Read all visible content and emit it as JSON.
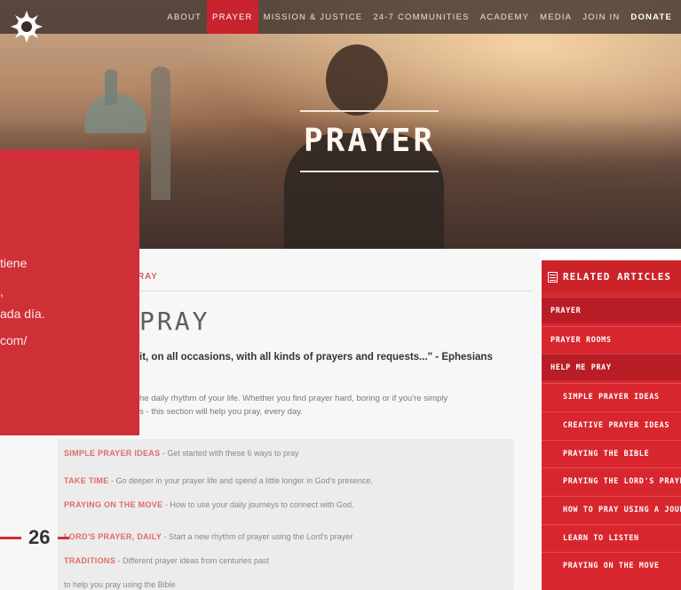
{
  "nav": {
    "items": [
      "ABOUT",
      "PRAYER",
      "MISSION & JUSTICE",
      "24-7 COMMUNITIES",
      "ACADEMY",
      "MEDIA",
      "JOIN IN",
      "DONATE"
    ],
    "active": "PRAYER"
  },
  "hero": {
    "title": "PRAYER"
  },
  "breadcrumb": "RAY",
  "page_title": "PRAY",
  "verse": {
    "line1": "it, on all occasions, with all kinds of prayers and requests...\" - Ephesians",
    "line2": ""
  },
  "intro": {
    "line1": "he daily rhythm of your life. Whether you find prayer hard, boring or if you're simply",
    "line2": "s - this section will help you pray, every day."
  },
  "list": [
    {
      "highlight": "SIMPLE PRAYER IDEAS",
      "text": " - Get started with these 6 ways to pray"
    },
    {
      "highlight": "TAKE TIME",
      "text": " - Go deeper in your prayer life and spend a little longer in God's presence."
    },
    {
      "highlight": "PRAYING ON THE MOVE",
      "text": " - How to use your daily journeys to connect with God."
    },
    {
      "highlight": "LORD'S PRAYER, DAILY",
      "text": " - Start a new rhythm of prayer using the Lord's prayer"
    },
    {
      "highlight": "TRADITIONS",
      "text": " - Different prayer ideas from centuries past"
    },
    {
      "highlight": "",
      "text": "to help you pray using the Bible"
    }
  ],
  "sidebar": {
    "header": "RELATED ARTICLES",
    "items": [
      {
        "label": "PRAYER",
        "dark": true
      },
      {
        "label": "PRAYER ROOMS",
        "dark": false
      },
      {
        "label": "HELP ME PRAY",
        "dark": true
      },
      {
        "label": "SIMPLE PRAYER IDEAS",
        "dark": false
      },
      {
        "label": "CREATIVE PRAYER IDEAS",
        "dark": false
      },
      {
        "label": "PRAYING THE BIBLE",
        "dark": false
      },
      {
        "label": "PRAYING THE LORD'S PRAYER, DA",
        "dark": false
      },
      {
        "label": "HOW TO PRAY USING A JOURNAL",
        "dark": false
      },
      {
        "label": "LEARN TO LISTEN",
        "dark": false
      },
      {
        "label": "PRAYING ON THE MOVE",
        "dark": false
      }
    ]
  },
  "card": {
    "lines": [
      "tiene",
      ",",
      "ada día.",
      "com/"
    ]
  },
  "page_number": "26",
  "colors": {
    "accent": "#c8242e",
    "sidebar": "#d8262f",
    "card": "#cf3037"
  }
}
